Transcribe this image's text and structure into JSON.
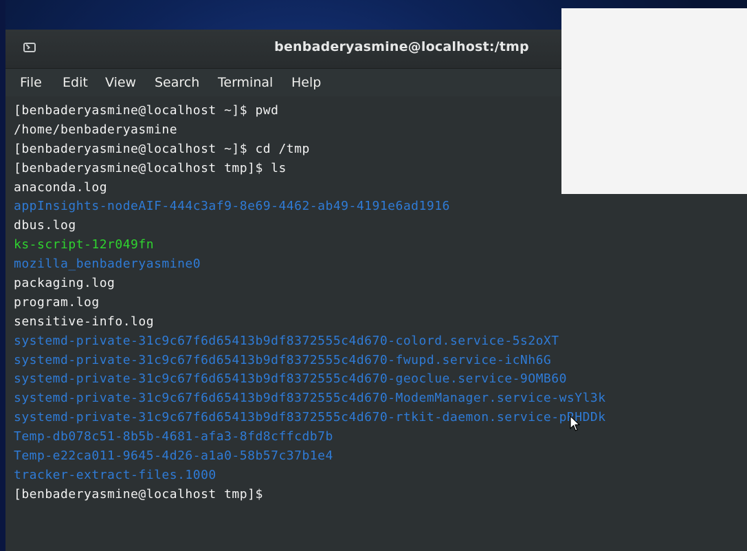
{
  "window": {
    "title": "benbaderyasmine@localhost:/tmp"
  },
  "menu": {
    "items": [
      "File",
      "Edit",
      "View",
      "Search",
      "Terminal",
      "Help"
    ]
  },
  "terminal": {
    "lines": [
      {
        "text": "[benbaderyasmine@localhost ~]$ pwd",
        "type": "default"
      },
      {
        "text": "/home/benbaderyasmine",
        "type": "default"
      },
      {
        "text": "[benbaderyasmine@localhost ~]$ cd /tmp",
        "type": "default"
      },
      {
        "text": "[benbaderyasmine@localhost tmp]$ ls",
        "type": "default"
      },
      {
        "text": "anaconda.log",
        "type": "default"
      },
      {
        "text": "appInsights-nodeAIF-444c3af9-8e69-4462-ab49-4191e6ad1916",
        "type": "dir"
      },
      {
        "text": "dbus.log",
        "type": "default"
      },
      {
        "text": "ks-script-12r049fn",
        "type": "exec"
      },
      {
        "text": "mozilla_benbaderyasmine0",
        "type": "dir"
      },
      {
        "text": "packaging.log",
        "type": "default"
      },
      {
        "text": "program.log",
        "type": "default"
      },
      {
        "text": "sensitive-info.log",
        "type": "default"
      },
      {
        "text": "systemd-private-31c9c67f6d65413b9df8372555c4d670-colord.service-5s2oXT",
        "type": "dir"
      },
      {
        "text": "systemd-private-31c9c67f6d65413b9df8372555c4d670-fwupd.service-icNh6G",
        "type": "dir"
      },
      {
        "text": "systemd-private-31c9c67f6d65413b9df8372555c4d670-geoclue.service-9OMB60",
        "type": "dir"
      },
      {
        "text": "systemd-private-31c9c67f6d65413b9df8372555c4d670-ModemManager.service-wsYl3k",
        "type": "dir"
      },
      {
        "text": "systemd-private-31c9c67f6d65413b9df8372555c4d670-rtkit-daemon.service-pRHDDk",
        "type": "dir"
      },
      {
        "text": "Temp-db078c51-8b5b-4681-afa3-8fd8cffcdb7b",
        "type": "dir"
      },
      {
        "text": "Temp-e22ca011-9645-4d26-a1a0-58b57c37b1e4",
        "type": "dir"
      },
      {
        "text": "tracker-extract-files.1000",
        "type": "dir"
      },
      {
        "text": "[benbaderyasmine@localhost tmp]$ ",
        "type": "default"
      }
    ]
  },
  "icons": {
    "window_icon": "terminal-window-icon",
    "cursor": "mouse-pointer-icon"
  },
  "colors": {
    "background": "#2c3133",
    "text": "#f2f2f2",
    "directory": "#2f7bd6",
    "executable": "#2fd32f"
  }
}
